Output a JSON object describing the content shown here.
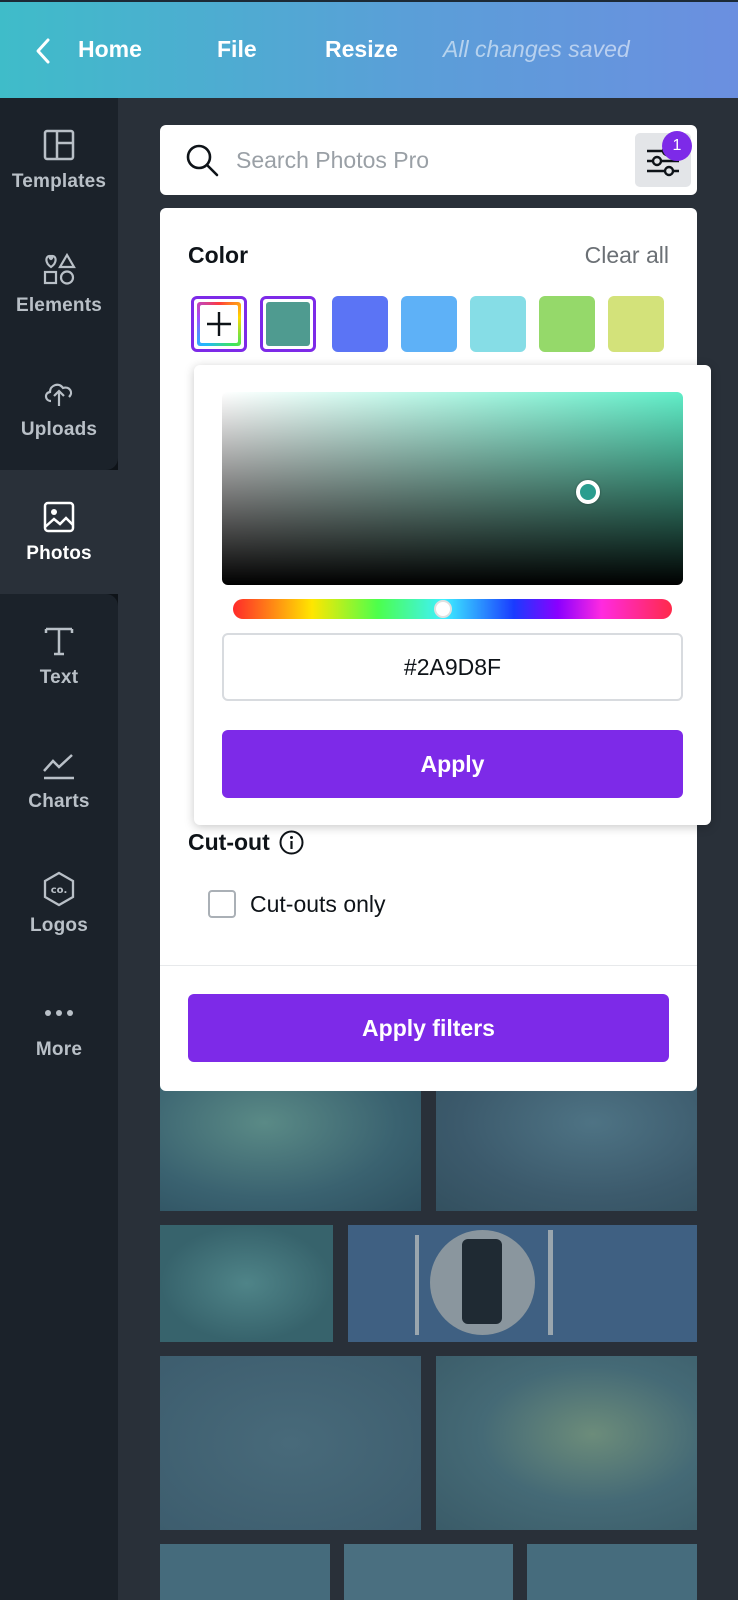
{
  "topbar": {
    "back_icon": "chevron-left-icon",
    "home": "Home",
    "file": "File",
    "resize": "Resize",
    "status": "All changes saved"
  },
  "rail": {
    "items": [
      {
        "label": "Templates",
        "icon": "templates-icon"
      },
      {
        "label": "Elements",
        "icon": "elements-icon"
      },
      {
        "label": "Uploads",
        "icon": "upload-cloud-icon"
      },
      {
        "label": "Photos",
        "icon": "photo-icon",
        "active": true
      },
      {
        "label": "Text",
        "icon": "text-icon"
      },
      {
        "label": "Charts",
        "icon": "chart-line-icon"
      },
      {
        "label": "Logos",
        "icon": "logo-badge-icon"
      },
      {
        "label": "More",
        "icon": "more-dots-icon"
      }
    ]
  },
  "search": {
    "placeholder": "Search Photos Pro",
    "filter_badge": "1"
  },
  "filters": {
    "color_heading": "Color",
    "clear_all": "Clear all",
    "swatches": [
      "#2A9D8F",
      "#5B74F5",
      "#5EB1F7",
      "#86DDE6",
      "#95D96A",
      "#D3E27A"
    ],
    "cutout_heading": "Cut-out",
    "cutout_option": "Cut-outs only",
    "apply_filters": "Apply filters"
  },
  "picker": {
    "hex_value": "#2A9D8F",
    "apply": "Apply"
  },
  "colors": {
    "accent": "#7D2AE8",
    "selected_color": "#2A9D8F"
  }
}
